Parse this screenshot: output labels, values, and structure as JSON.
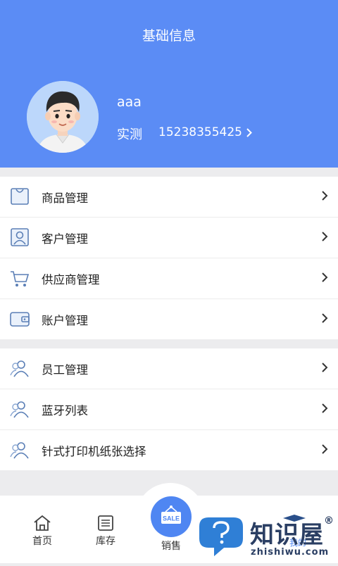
{
  "header": {
    "title": "基础信息",
    "username": "aaa",
    "role": "实测",
    "phone": "15238355425",
    "bg_color": "#5b8cf5"
  },
  "menu_group_1": [
    {
      "label": "商品管理",
      "icon": "shopping-bag-icon"
    },
    {
      "label": "客户管理",
      "icon": "customer-id-icon"
    },
    {
      "label": "供应商管理",
      "icon": "shopping-cart-icon"
    },
    {
      "label": "账户管理",
      "icon": "wallet-icon"
    }
  ],
  "menu_group_2": [
    {
      "label": "员工管理",
      "icon": "users-icon"
    },
    {
      "label": "蓝牙列表",
      "icon": "users-icon"
    },
    {
      "label": "针式打印机纸张选择",
      "icon": "users-icon"
    }
  ],
  "tabbar": {
    "home": "首页",
    "inventory": "库存",
    "sales": "销售",
    "mine": "我的",
    "sale_badge": "SALE",
    "accent": "#4f86f2"
  },
  "watermark": {
    "text": "知识屋",
    "reg": "®",
    "domain": "zhishiwu.com"
  }
}
